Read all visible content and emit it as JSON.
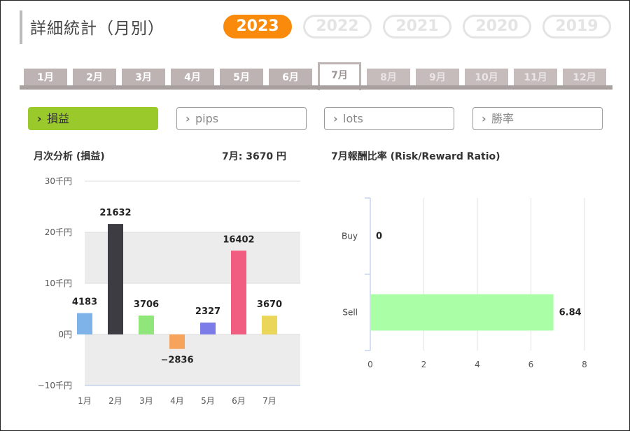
{
  "page": {
    "title": "詳細統計（月別）"
  },
  "years": [
    {
      "label": "2023",
      "active": true
    },
    {
      "label": "2022",
      "active": false
    },
    {
      "label": "2021",
      "active": false
    },
    {
      "label": "2020",
      "active": false
    },
    {
      "label": "2019",
      "active": false
    }
  ],
  "months": [
    {
      "label": "1月",
      "state": "normal"
    },
    {
      "label": "2月",
      "state": "normal"
    },
    {
      "label": "3月",
      "state": "normal"
    },
    {
      "label": "4月",
      "state": "normal"
    },
    {
      "label": "5月",
      "state": "normal"
    },
    {
      "label": "6月",
      "state": "normal"
    },
    {
      "label": "7月",
      "state": "active"
    },
    {
      "label": "8月",
      "state": "inactive"
    },
    {
      "label": "9月",
      "state": "inactive"
    },
    {
      "label": "10月",
      "state": "inactive"
    },
    {
      "label": "11月",
      "state": "inactive"
    },
    {
      "label": "12月",
      "state": "inactive"
    }
  ],
  "metrics": [
    {
      "label": "損益",
      "active": true
    },
    {
      "label": "pips",
      "active": false
    },
    {
      "label": "lots",
      "active": false
    },
    {
      "label": "勝率",
      "active": false
    }
  ],
  "left_panel": {
    "title": "月次分析 (損益)",
    "summary": "7月:  3670 円"
  },
  "right_panel": {
    "title": "7月報酬比率 (Risk/Reward Ratio)"
  },
  "colors": {
    "accent": "#f98a0c",
    "metric_active": "#9ac92c",
    "tab": "#bdb3b3"
  },
  "chart_data": [
    {
      "type": "bar",
      "categories": [
        "1月",
        "2月",
        "3月",
        "4月",
        "5月",
        "6月",
        "7月"
      ],
      "values": [
        4183,
        21632,
        3706,
        -2836,
        2327,
        16402,
        3670
      ],
      "colors": [
        "#7eb3e9",
        "#3d3c42",
        "#90e57b",
        "#f6a35c",
        "#7c7ce8",
        "#f15c81",
        "#ead75a"
      ],
      "ylim": [
        -10000,
        30000
      ],
      "yticks": [
        30000,
        20000,
        10000,
        0,
        -10000
      ],
      "ytick_labels": [
        "30千円",
        "20千円",
        "10千円",
        "0円",
        "−10千円"
      ],
      "grid_bands": true
    },
    {
      "type": "bar",
      "orientation": "horizontal",
      "categories": [
        "Buy",
        "Sell"
      ],
      "values": [
        0,
        6.84
      ],
      "value_labels": [
        "0",
        "6.84"
      ],
      "color": "#aaffa6",
      "xlim": [
        0,
        8
      ],
      "xticks": [
        0,
        2,
        4,
        6,
        8
      ]
    }
  ]
}
